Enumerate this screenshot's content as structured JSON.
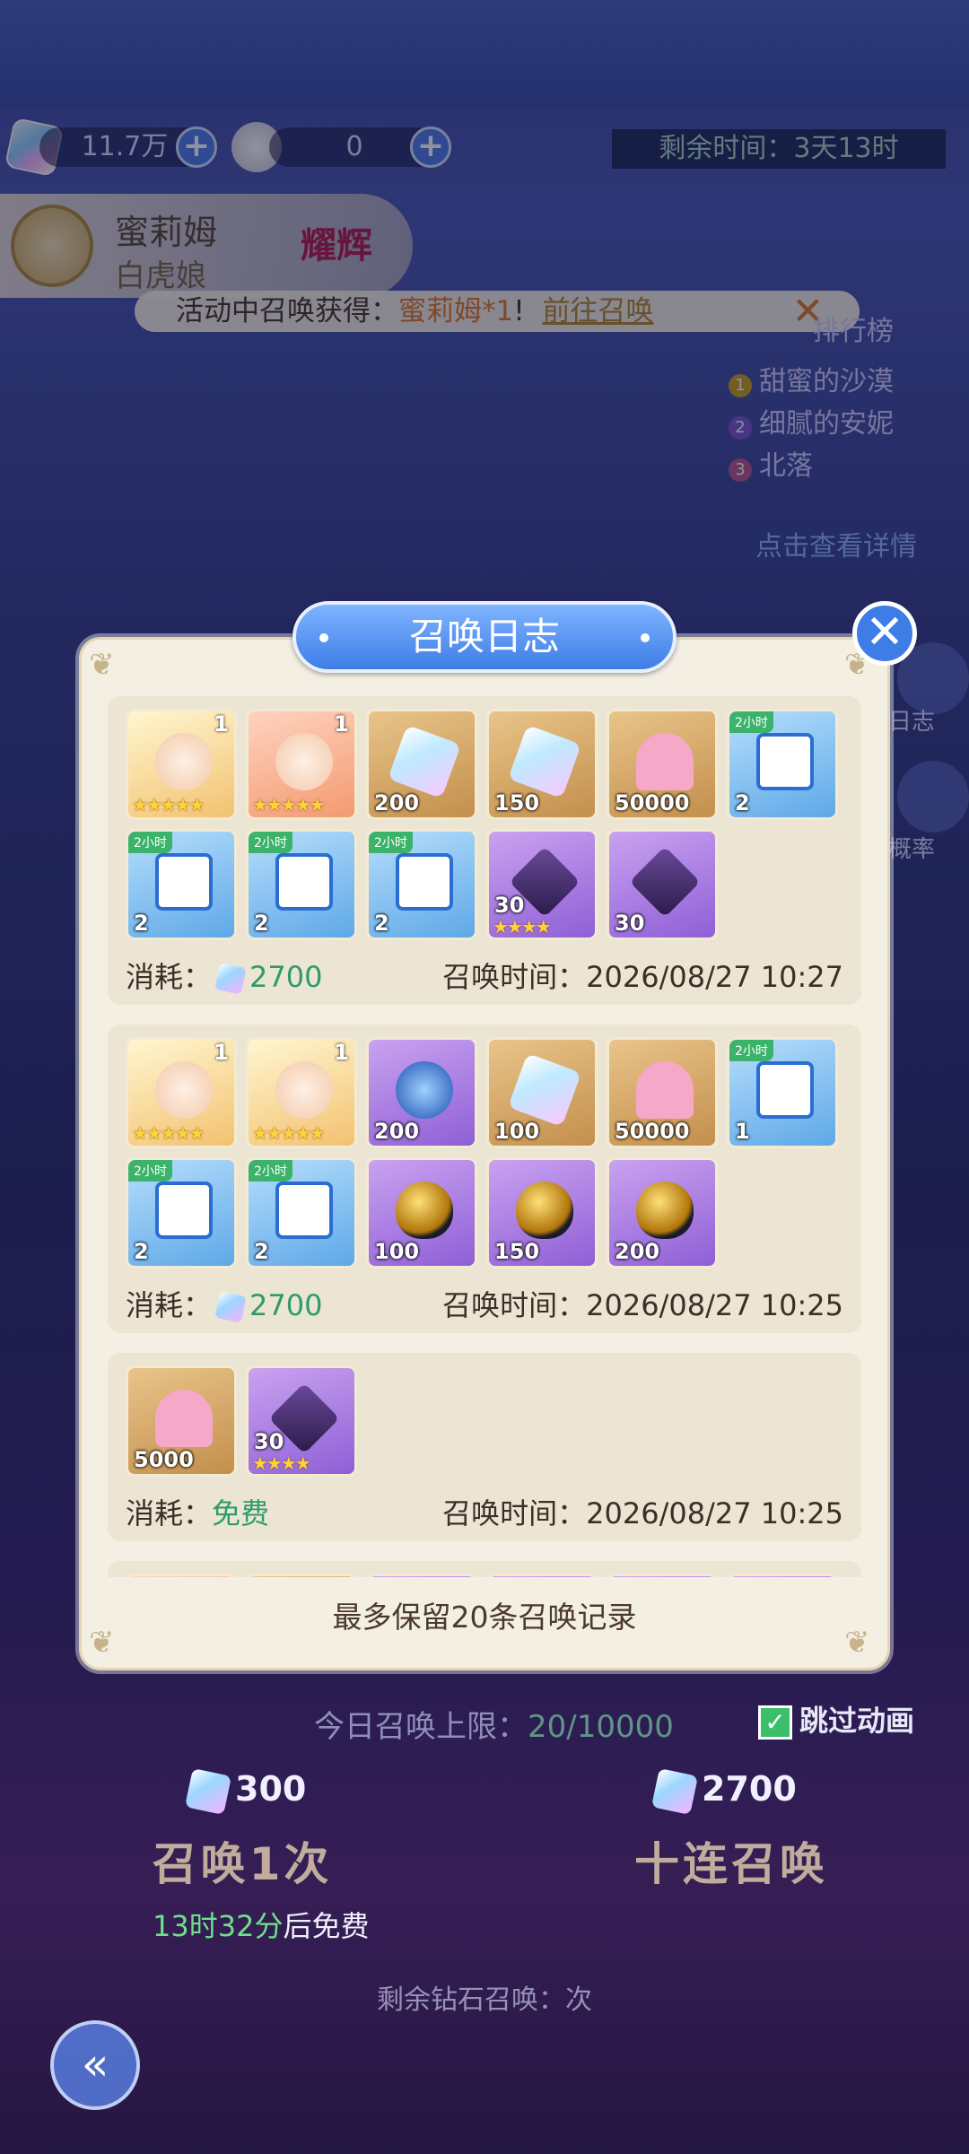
{
  "resources": {
    "gem_amount": "11.7万",
    "ticket_amount": "0"
  },
  "remaining_time": "剩余时间：3天13时",
  "hero": {
    "name": "蜜莉姆",
    "subtitle": "白虎娘",
    "badge": "耀辉"
  },
  "banner": {
    "prefix": "活动中召唤获得：",
    "reward": "蜜莉姆*1",
    "mark": "!",
    "link": "前往召唤",
    "close": "✕"
  },
  "ranking": {
    "title": "排行榜",
    "items": [
      "甜蜜的沙漠",
      "细腻的安妮",
      "北落"
    ],
    "detail_link": "点击查看详情"
  },
  "side_buttons": {
    "log": "日志",
    "rate": "概率"
  },
  "modal": {
    "title": "召唤日志",
    "close": "✕",
    "footer": "最多保留20条召唤记录",
    "cost_label": "消耗：",
    "time_label": "召唤时间：",
    "entries": [
      {
        "cost": "2700",
        "time": "2026/08/27 10:27",
        "items": [
          {
            "kind": "char",
            "icon": "hero-portrait-icon",
            "level": "1",
            "stars": "★★★★★",
            "qty": ""
          },
          {
            "kind": "char2",
            "icon": "hero-portrait-icon",
            "level": "1",
            "stars": "★★★★★",
            "qty": ""
          },
          {
            "kind": "gold",
            "icon": "crystal-icon",
            "qty": "200"
          },
          {
            "kind": "gold",
            "icon": "crystal-icon",
            "qty": "150"
          },
          {
            "kind": "gold",
            "icon": "exp-heart-icon",
            "qty": "50000"
          },
          {
            "kind": "blue",
            "icon": "treasure-chest-icon",
            "tag": "2小时",
            "qty": "2"
          },
          {
            "kind": "blue",
            "icon": "treasure-chest-icon",
            "tag": "2小时",
            "qty": "2"
          },
          {
            "kind": "blue",
            "icon": "treasure-chest-icon",
            "tag": "2小时",
            "qty": "2"
          },
          {
            "kind": "blue",
            "icon": "treasure-chest-icon",
            "tag": "2小时",
            "qty": "2"
          },
          {
            "kind": "purple",
            "icon": "dark-crystal-icon",
            "stars": "★★★★",
            "qty": "30"
          },
          {
            "kind": "purple",
            "icon": "dark-crystal-icon",
            "qty": "30"
          }
        ]
      },
      {
        "cost": "2700",
        "time": "2026/08/27 10:25",
        "items": [
          {
            "kind": "char",
            "icon": "hero-portrait-icon",
            "level": "1",
            "stars": "★★★★★",
            "qty": ""
          },
          {
            "kind": "char",
            "icon": "hero-portrait-icon",
            "level": "1",
            "stars": "★★★★★",
            "qty": ""
          },
          {
            "kind": "purple",
            "icon": "crystal-orb-icon",
            "qty": "200"
          },
          {
            "kind": "gold",
            "icon": "crystal-icon",
            "qty": "100"
          },
          {
            "kind": "gold",
            "icon": "exp-heart-icon",
            "qty": "50000"
          },
          {
            "kind": "blue",
            "icon": "treasure-chest-icon",
            "tag": "2小时",
            "qty": "1"
          },
          {
            "kind": "blue",
            "icon": "treasure-chest-icon",
            "tag": "2小时",
            "qty": "2"
          },
          {
            "kind": "blue",
            "icon": "treasure-chest-icon",
            "tag": "2小时",
            "qty": "2"
          },
          {
            "kind": "purple",
            "icon": "golden-egg-icon",
            "qty": "100"
          },
          {
            "kind": "purple",
            "icon": "golden-egg-icon",
            "qty": "150"
          },
          {
            "kind": "purple",
            "icon": "golden-egg-icon",
            "qty": "200"
          }
        ]
      },
      {
        "cost": "免费",
        "time": "2026/08/27 10:25",
        "items": [
          {
            "kind": "gold",
            "icon": "exp-heart-icon",
            "qty": "5000"
          },
          {
            "kind": "purple",
            "icon": "dark-crystal-icon",
            "stars": "★★★★",
            "qty": "30"
          }
        ]
      },
      {
        "cost": "",
        "time": "",
        "items": [
          {
            "kind": "char2",
            "icon": "hero-portrait-icon",
            "level": "1",
            "qty": ""
          },
          {
            "kind": "gold",
            "icon": "weapon-icon",
            "qty": ""
          },
          {
            "kind": "purple",
            "icon": "crystal-orb-icon",
            "qty": ""
          },
          {
            "kind": "purple",
            "icon": "crystal-orb-icon",
            "qty": ""
          },
          {
            "kind": "purple",
            "icon": "crystal-orb-icon",
            "qty": ""
          },
          {
            "kind": "purple",
            "icon": "crystal-orb-icon",
            "qty": ""
          }
        ]
      }
    ]
  },
  "summon": {
    "daily_limit_label": "今日召唤上限：",
    "daily_limit_value": "20/10000",
    "skip_label": "跳过动画",
    "single_cost": "300",
    "ten_cost": "2700",
    "single_label": "召唤1次",
    "ten_label": "十连召唤",
    "free_timer": "13时32分",
    "free_suffix": "后免费",
    "diamond_prefix": "剩余钻石召唤：",
    "diamond_suffix": "次"
  }
}
